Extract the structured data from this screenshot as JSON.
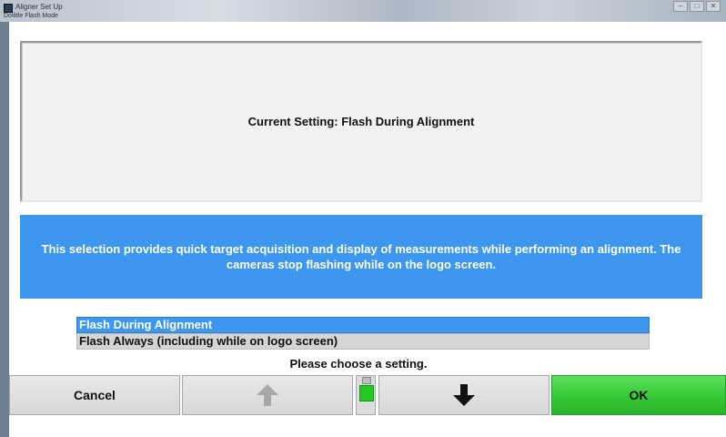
{
  "window": {
    "title": "Aligner Set Up",
    "subtitle": "Dolittle Flash Mode",
    "controls": {
      "minimize": "–",
      "maximize": "□",
      "close": "✕"
    }
  },
  "current_setting": {
    "text": "Current Setting:  Flash During Alignment"
  },
  "description": {
    "text": "This selection provides quick target acquisition and display of measurements while performing an alignment.  The cameras stop flashing while on the logo screen."
  },
  "options": {
    "items": [
      {
        "label": "Flash During Alignment",
        "selected": true
      },
      {
        "label": "Flash Always (including while on logo screen)",
        "selected": false
      }
    ]
  },
  "prompt": {
    "text": "Please choose a setting."
  },
  "buttons": {
    "cancel": "Cancel",
    "up_icon": "up-arrow-icon",
    "down_icon": "down-arrow-icon",
    "ok": "OK"
  },
  "colors": {
    "accent_blue": "#3d97ee",
    "ok_green": "#33c533",
    "panel_gray": "#f2f2f2"
  }
}
